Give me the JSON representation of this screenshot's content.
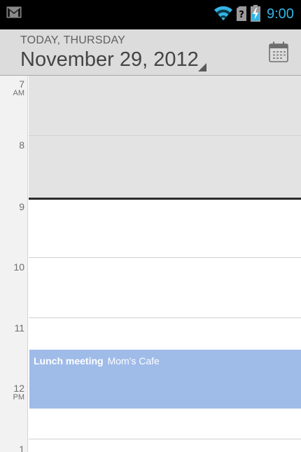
{
  "status_bar": {
    "time": "9:00",
    "icons": [
      "gmail-icon",
      "wifi-icon",
      "sim-missing-icon",
      "battery-charging-icon"
    ],
    "time_color": "#33b5e5"
  },
  "header": {
    "subtitle": "TODAY, THURSDAY",
    "date": "November 29, 2012",
    "calendar_icon": "calendar-icon"
  },
  "day_view": {
    "hours": [
      {
        "num": "7",
        "ampm": "AM"
      },
      {
        "num": "8",
        "ampm": ""
      },
      {
        "num": "9",
        "ampm": ""
      },
      {
        "num": "10",
        "ampm": ""
      },
      {
        "num": "11",
        "ampm": ""
      },
      {
        "num": "12",
        "ampm": "PM"
      },
      {
        "num": "1",
        "ampm": ""
      }
    ],
    "events": [
      {
        "title": "Lunch meeting",
        "location": "Mom's Cafe",
        "color": "#9fbbe8"
      }
    ]
  }
}
